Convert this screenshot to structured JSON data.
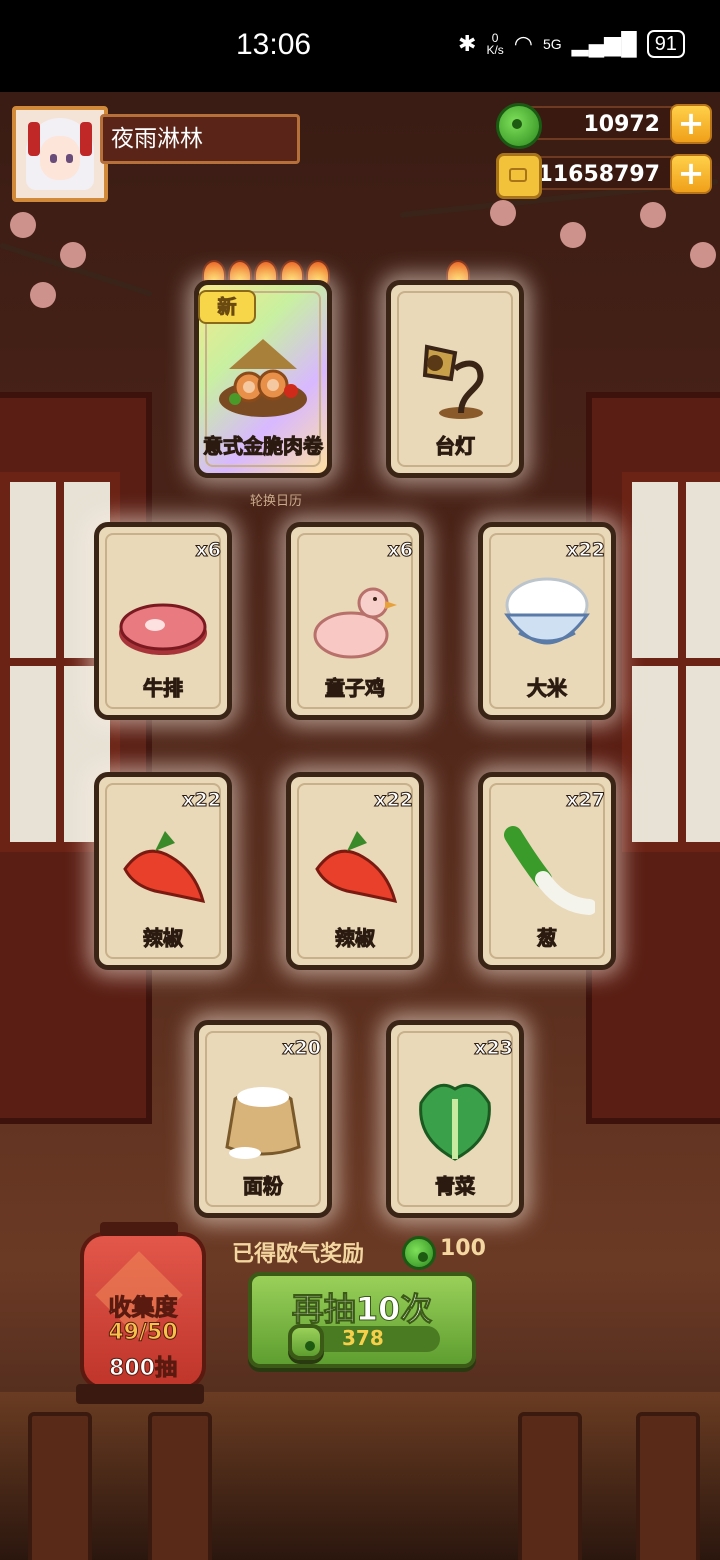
{
  "status_bar": {
    "time": "13:06",
    "net_speed_value": "0",
    "net_speed_unit": "K/s",
    "network": "5G",
    "battery": "91"
  },
  "player": {
    "name": "夜雨淋林"
  },
  "resources": {
    "jade": "10972",
    "coins": "11658797"
  },
  "featured_cards": [
    {
      "label": "意式金脆肉卷",
      "flames": 5,
      "is_new": true
    },
    {
      "label": "台灯",
      "flames": 1,
      "is_new": false
    }
  ],
  "new_badge": "新",
  "calendar_caption": "轮换日历",
  "cards": [
    {
      "label": "牛排",
      "count": "x6"
    },
    {
      "label": "童子鸡",
      "count": "x6"
    },
    {
      "label": "大米",
      "count": "x22"
    },
    {
      "label": "辣椒",
      "count": "x22"
    },
    {
      "label": "辣椒",
      "count": "x22"
    },
    {
      "label": "葱",
      "count": "x27"
    },
    {
      "label": "面粉",
      "count": "x20"
    },
    {
      "label": "青菜",
      "count": "x23"
    }
  ],
  "collection": {
    "title": "收集度",
    "progress": "49/50",
    "pulls": "800抽"
  },
  "luck_reward": {
    "label": "已得欧气奖励",
    "value": "100"
  },
  "draw_button": {
    "label": "再抽10次",
    "cost": "378"
  },
  "colors": {
    "accent_green": "#5e9e30",
    "card_bg": "#e9d9b8",
    "wood": "#5a1e14"
  }
}
